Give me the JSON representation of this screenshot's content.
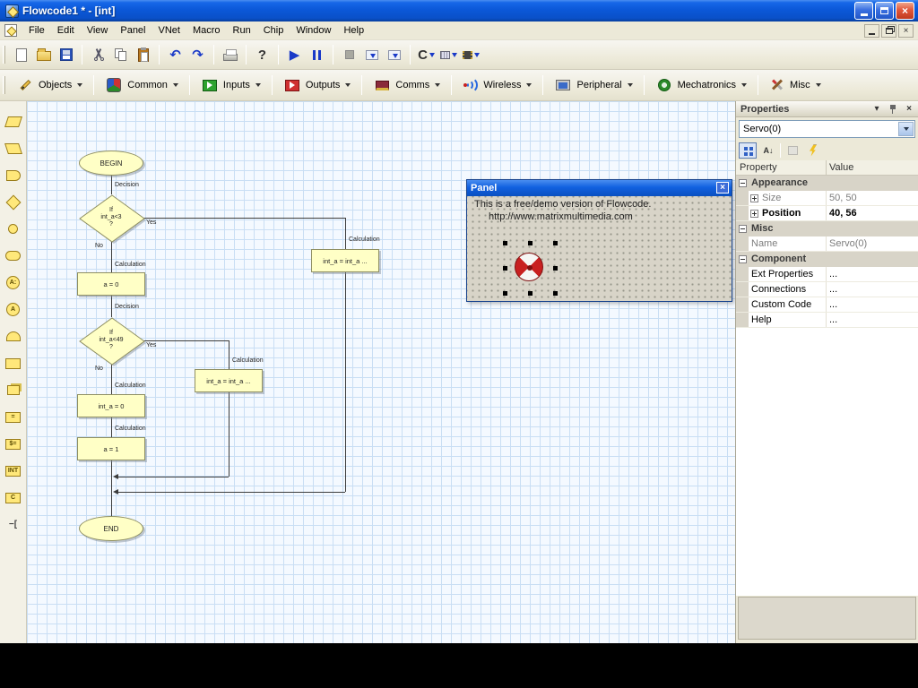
{
  "window": {
    "title": "Flowcode1 * - [int]",
    "close_glyph": "×"
  },
  "menu": {
    "items": [
      "File",
      "Edit",
      "View",
      "Panel",
      "VNet",
      "Macro",
      "Run",
      "Chip",
      "Window",
      "Help"
    ],
    "mdi_close_glyph": "×"
  },
  "toolbar": {
    "undo_glyph": "↶",
    "redo_glyph": "↷",
    "help_glyph": "?",
    "run_glyph": "▶",
    "c_glyph": "C"
  },
  "components": {
    "groups": [
      "Objects",
      "Common",
      "Inputs",
      "Outputs",
      "Comms",
      "Wireless",
      "Peripheral",
      "Mechatronics",
      "Misc"
    ]
  },
  "left_toolbar": {
    "macro_glyph": "A:",
    "call_macro_glyph": "A",
    "calculation_glyph": "=",
    "string_glyph": "$=",
    "interrupt_glyph": "INT",
    "ccode_glyph": "C",
    "comment_glyph": "−["
  },
  "flowchart": {
    "begin": "BEGIN",
    "end": "END",
    "decision_caption": "Decision",
    "calculation_caption": "Calculation",
    "yes": "Yes",
    "no": "No",
    "decision1_text": "If\nint_a<3\n?",
    "decision2_text": "If\nint_a<49\n?",
    "calc1_text": "a = 0",
    "calc2_text": "int_a = 0",
    "calc3_text": "a = 1",
    "branch_calc_text": "int_a = int_a ..."
  },
  "panel": {
    "title": "Panel",
    "close_glyph": "×",
    "line1": "This is a free/demo version of Flowcode.",
    "line2": "http://www.matrixmultimedia.com"
  },
  "properties": {
    "title": "Properties",
    "chevron_glyph": "▾",
    "close_glyph": "×",
    "selected": "Servo(0)",
    "sort_glyph": "A↓",
    "col_property": "Property",
    "col_value": "Value",
    "rows": [
      {
        "type": "category",
        "label": "Appearance",
        "value": ""
      },
      {
        "type": "item",
        "label": "Size",
        "value": "50, 50"
      },
      {
        "type": "item",
        "label": "Position",
        "value": "40, 56"
      },
      {
        "type": "category",
        "label": "Misc",
        "value": ""
      },
      {
        "type": "item",
        "label": "Name",
        "value": "Servo(0)"
      },
      {
        "type": "category",
        "label": "Component",
        "value": ""
      },
      {
        "type": "item",
        "label": "Ext Properties",
        "value": "..."
      },
      {
        "type": "item",
        "label": "Connections",
        "value": "..."
      },
      {
        "type": "item",
        "label": "Custom Code",
        "value": "..."
      },
      {
        "type": "item",
        "label": "Help",
        "value": "..."
      }
    ]
  }
}
